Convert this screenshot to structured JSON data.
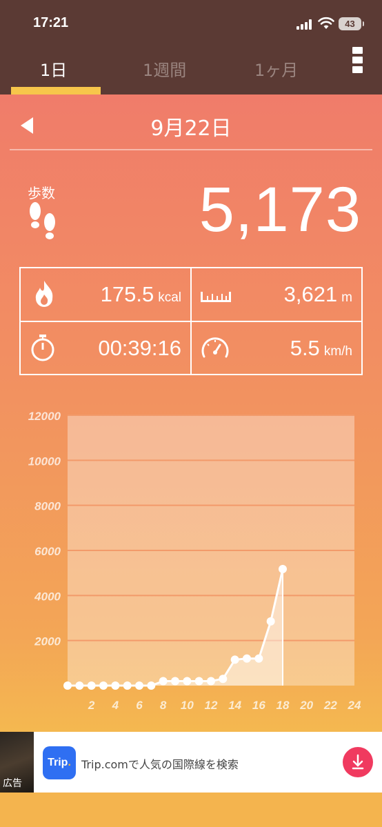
{
  "status_bar": {
    "time": "17:21",
    "battery": "43"
  },
  "tabs": [
    {
      "label": "1日",
      "active": true
    },
    {
      "label": "1週間",
      "active": false
    },
    {
      "label": "1ヶ月",
      "active": false
    }
  ],
  "date": "9月22日",
  "steps": {
    "label": "歩数",
    "value": "5,173"
  },
  "stats": {
    "calories": {
      "value": "175.5",
      "unit": "kcal"
    },
    "distance": {
      "value": "3,621",
      "unit": "m"
    },
    "duration": {
      "value": "00:39:16"
    },
    "speed": {
      "value": "5.5",
      "unit": "km/h"
    }
  },
  "chart_data": {
    "type": "area",
    "x": [
      0,
      1,
      2,
      3,
      4,
      5,
      6,
      7,
      8,
      9,
      10,
      11,
      12,
      13,
      14,
      15,
      16,
      17,
      18
    ],
    "values": [
      0,
      0,
      0,
      0,
      0,
      0,
      0,
      0,
      200,
      200,
      200,
      200,
      200,
      300,
      1150,
      1200,
      1200,
      2850,
      5173
    ],
    "x_ticks": [
      "2",
      "4",
      "6",
      "8",
      "10",
      "12",
      "14",
      "16",
      "18",
      "20",
      "22",
      "24"
    ],
    "y_ticks": [
      "2000",
      "4000",
      "6000",
      "8000",
      "10000",
      "12000"
    ],
    "xlim": [
      0,
      24
    ],
    "ylim": [
      0,
      12000
    ],
    "grid": true
  },
  "colors": {
    "header": "#5b3a34",
    "tab_indicator": "#f7c64b",
    "gradient_top": "#f07c6a",
    "gradient_bottom": "#f4b850",
    "ad_accent": "#f03a5f",
    "trip_blue": "#2f6ff2"
  },
  "ad": {
    "thumb_label": "広告",
    "logo_text": "Trip",
    "text": "Trip.comで人気の国際線を検索",
    "icons": [
      "download-icon"
    ]
  }
}
